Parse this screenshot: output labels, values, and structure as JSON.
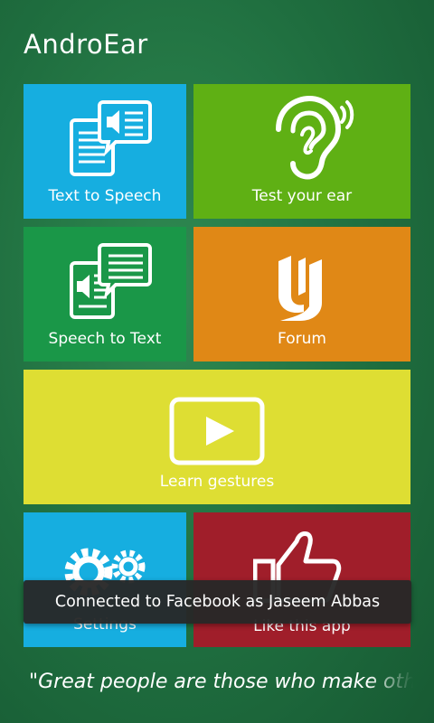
{
  "app": {
    "title": "AndroEar"
  },
  "tiles": {
    "text_to_speech": {
      "label": "Text to Speech",
      "color": "#16aee0",
      "icon": "document-speaker-icon"
    },
    "test_your_ear": {
      "label": "Test your ear",
      "color": "#5fb014",
      "icon": "ear-icon"
    },
    "speech_to_text": {
      "label": "Speech to Text",
      "color": "#1a9748",
      "icon": "speaker-document-icon"
    },
    "forum": {
      "label": "Forum",
      "color": "#e08816",
      "icon": "forum-logo-icon"
    },
    "learn_gestures": {
      "label": "Learn gestures",
      "color": "#dede33",
      "icon": "play-icon"
    },
    "settings": {
      "label": "Settings",
      "color": "#16aee0",
      "icon": "gears-icon"
    },
    "like_app": {
      "label": "Like this app",
      "color": "#a01e2a",
      "icon": "thumbs-up-icon"
    }
  },
  "toast": {
    "message": "Connected to Facebook as Jaseem Abbas"
  },
  "quote": {
    "text": "\"Great people are those who make others feel that they too can become great\""
  }
}
